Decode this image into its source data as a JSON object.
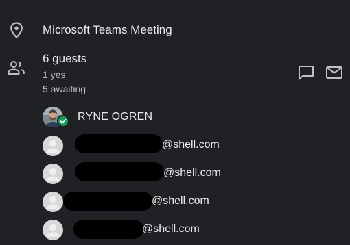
{
  "location": {
    "icon": "location-pin-icon",
    "text": "Microsoft Teams Meeting"
  },
  "guests": {
    "icon": "people-icon",
    "count_label": "6 guests",
    "yes_label": "1 yes",
    "awaiting_label": "5 awaiting",
    "actions": [
      {
        "name": "chat-icon"
      },
      {
        "name": "email-icon"
      }
    ],
    "list": [
      {
        "name": "RYNE OGREN",
        "status": "accepted",
        "avatar": "photo"
      },
      {
        "email_suffix": "@shell.com",
        "avatar": "default",
        "redacted": true
      },
      {
        "email_suffix": "@shell.com",
        "avatar": "default",
        "redacted": true
      },
      {
        "email_suffix": "@shell.com",
        "avatar": "default",
        "redacted": true
      },
      {
        "email_suffix": "@shell.com",
        "avatar": "default",
        "redacted": true
      }
    ]
  },
  "colors": {
    "background": "#202124",
    "text": "#e8eaed",
    "secondary_text": "#bdc1c6",
    "accepted_badge": "#0f9d58",
    "redaction": "#000000"
  }
}
